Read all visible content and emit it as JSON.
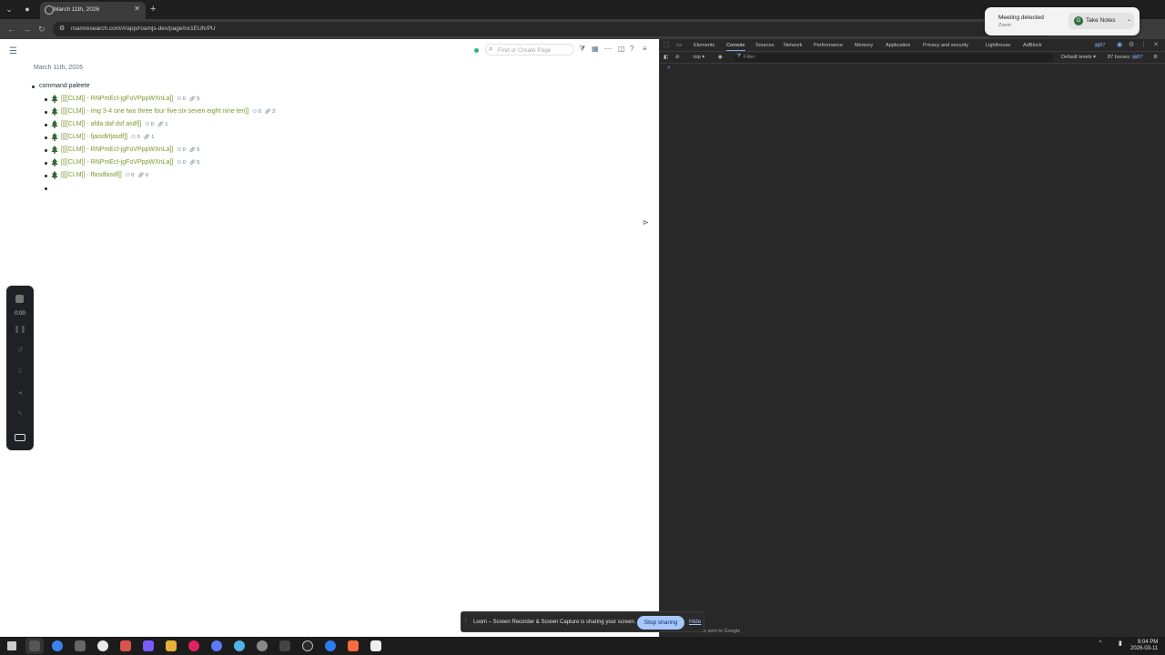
{
  "browser": {
    "tab_title": "March 11th, 2026",
    "url": "roamresearch.com/#/app/roamjs-dev/page/nx1EUhrPU"
  },
  "meeting_popup": {
    "title": "Meeting detected",
    "subtitle": "Zoom",
    "button_label": "Take Notes"
  },
  "roam": {
    "search_placeholder": "Find or Create Page",
    "page_title": "March 11th, 2026",
    "parent_block": "command paleete",
    "children": [
      {
        "text": "[[[[CLM]] - RNPmEcI-jgFoVPppWXnLa]]",
        "a": "0",
        "b": "5"
      },
      {
        "text": "[[[[CLM]] - img 3-4 one two three four five six seven eight nine ten]]",
        "a": "0",
        "b": "2"
      },
      {
        "text": "[[[[CLM]] - afda daf dsf asdf]]",
        "a": "0",
        "b": "1"
      },
      {
        "text": "[[[[CLM]] - fjaisdkfjasdf]]",
        "a": "0",
        "b": "1"
      },
      {
        "text": "[[[[CLM]] - RNPmEcI-jgFoVPppWXnLa]]",
        "a": "0",
        "b": "5"
      },
      {
        "text": "[[[[CLM]] - RNPmEcI-jgFoVPppWXnLa]]",
        "a": "0",
        "b": "5"
      },
      {
        "text": "[[[[CLM]] - ffasdfasdf]]",
        "a": "0",
        "b": "0"
      }
    ]
  },
  "loom_widget": {
    "time": "0:00"
  },
  "devtools": {
    "tabs": [
      "Elements",
      "Console",
      "Sources",
      "Network",
      "Performance",
      "Memory",
      "Application",
      "Privacy and security",
      "Lighthouse",
      "AdBlock"
    ],
    "active_tab": "Console",
    "badge_count": "87",
    "context": "top",
    "filter_placeholder": "Filter",
    "levels": "Default levels",
    "issues": "87 Issues:",
    "issues_count": "87",
    "prompt": ">"
  },
  "loom_banner": {
    "message": "Loom – Screen Recorder & Screen Capture is sharing your screen.",
    "stop_label": "Stop sharing",
    "hide_label": "Hide",
    "behind_text": "is sent to Google"
  },
  "taskbar": {
    "time": "9:04 PM",
    "date": "2026-03-11"
  },
  "colors": {
    "link_green": "#7a9a2e",
    "status_dot": "#2fb67c",
    "stop_button": "#a8c7fa"
  }
}
